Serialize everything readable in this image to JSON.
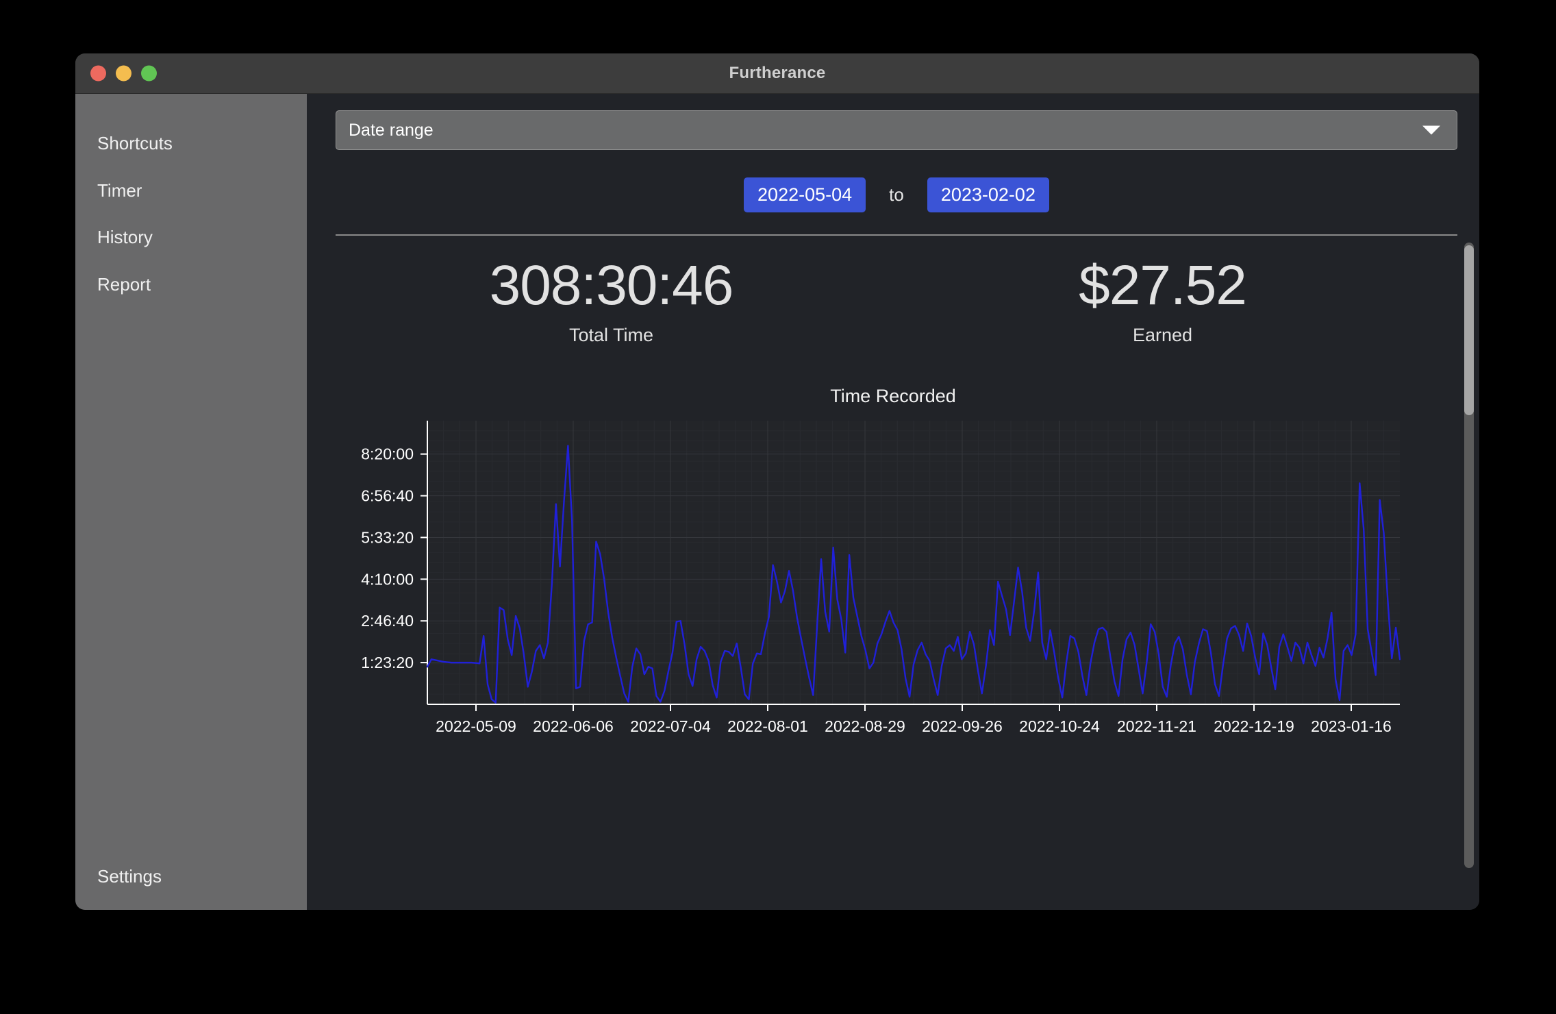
{
  "window": {
    "title": "Furtherance",
    "controls": [
      {
        "name": "close",
        "color": "#ed6a5f"
      },
      {
        "name": "minimize",
        "color": "#f4bd4f"
      },
      {
        "name": "maximize",
        "color": "#61c554"
      }
    ]
  },
  "sidebar": {
    "items": [
      {
        "label": "Shortcuts"
      },
      {
        "label": "Timer"
      },
      {
        "label": "History"
      },
      {
        "label": "Report"
      }
    ],
    "settings_label": "Settings"
  },
  "toolbar": {
    "range_select_value": "Date range",
    "chevron_icon": "chevron-down-icon"
  },
  "date_range": {
    "start": "2022-05-04",
    "to_label": "to",
    "end": "2023-02-02",
    "chip_color": "#3b54d6"
  },
  "stats": [
    {
      "value": "308:30:46",
      "label": "Total Time"
    },
    {
      "value": "$27.52",
      "label": "Earned"
    }
  ],
  "chart_data": {
    "type": "line",
    "title": "Time Recorded",
    "xlabel": "",
    "ylabel": "",
    "line_color": "#2020d8",
    "grid": true,
    "legend": null,
    "ytick_labels": [
      "1:23:20",
      "2:46:40",
      "4:10:00",
      "5:33:20",
      "6:56:40",
      "8:20:00"
    ],
    "ytick_values": [
      5000,
      10000,
      15000,
      20000,
      25000,
      30000
    ],
    "ylim": [
      0,
      34000
    ],
    "xtick_labels": [
      "2022-05-09",
      "2022-06-06",
      "2022-07-04",
      "2022-08-01",
      "2022-08-29",
      "2022-09-26",
      "2022-10-24",
      "2022-11-21",
      "2022-12-19",
      "2023-01-16"
    ],
    "xlim": [
      "2022-05-04",
      "2023-02-02"
    ],
    "series": [
      {
        "name": "Time Recorded",
        "values": [
          4500,
          5400,
          5300,
          5200,
          5100,
          5050,
          5000,
          5000,
          5000,
          5000,
          5000,
          5000,
          4950,
          4900,
          8200,
          2400,
          600,
          200,
          11600,
          11300,
          7800,
          5900,
          10600,
          9100,
          6000,
          2100,
          3900,
          6400,
          7100,
          5500,
          7400,
          14500,
          24000,
          16500,
          24300,
          31000,
          22000,
          1900,
          2100,
          7600,
          9600,
          9800,
          19500,
          18000,
          15000,
          11000,
          8000,
          5600,
          3400,
          1300,
          300,
          4500,
          6700,
          6000,
          3600,
          4500,
          4300,
          1000,
          300,
          1600,
          4000,
          6200,
          9900,
          10000,
          7200,
          3600,
          2200,
          5400,
          6900,
          6400,
          5200,
          2300,
          800,
          5100,
          6400,
          6300,
          5800,
          7300,
          4400,
          1200,
          600,
          4900,
          6100,
          6000,
          8500,
          10500,
          16700,
          14700,
          12200,
          13600,
          16000,
          13600,
          10400,
          7900,
          5500,
          3200,
          1100,
          9500,
          17400,
          11100,
          8700,
          18800,
          12600,
          10200,
          6200,
          17900,
          12800,
          10500,
          8200,
          6500,
          4300,
          5000,
          7300,
          8400,
          9900,
          11200,
          9800,
          8900,
          6600,
          3100,
          900,
          4800,
          6500,
          7400,
          6000,
          5200,
          3000,
          1100,
          4600,
          6700,
          7100,
          6400,
          8100,
          5400,
          6100,
          8700,
          7200,
          4100,
          1300,
          4600,
          8900,
          7100,
          14700,
          13000,
          11400,
          8300,
          12300,
          16400,
          13500,
          9200,
          7600,
          11200,
          15800,
          7400,
          5400,
          8900,
          6200,
          3100,
          800,
          5000,
          8200,
          7900,
          6300,
          3400,
          1100,
          4900,
          7400,
          9000,
          9200,
          8700,
          5600,
          2700,
          1000,
          5400,
          7800,
          8600,
          7100,
          4200,
          1300,
          5000,
          9600,
          8700,
          6000,
          2100,
          900,
          4700,
          7300,
          8100,
          6600,
          3500,
          1200,
          5100,
          7300,
          9000,
          8800,
          6100,
          2400,
          1000,
          4700,
          7900,
          9100,
          9400,
          8300,
          6400,
          9700,
          8200,
          5600,
          3600,
          8500,
          7100,
          4400,
          1800,
          6900,
          8400,
          6900,
          5200,
          7400,
          6800,
          4900,
          7400,
          5900,
          4600,
          6800,
          5600,
          7900,
          11000,
          3000,
          500,
          6400,
          7100,
          5900,
          8400,
          26500,
          21000,
          9000,
          6200,
          3500,
          24500,
          20500,
          12400,
          5500,
          9200,
          5400
        ]
      }
    ]
  }
}
